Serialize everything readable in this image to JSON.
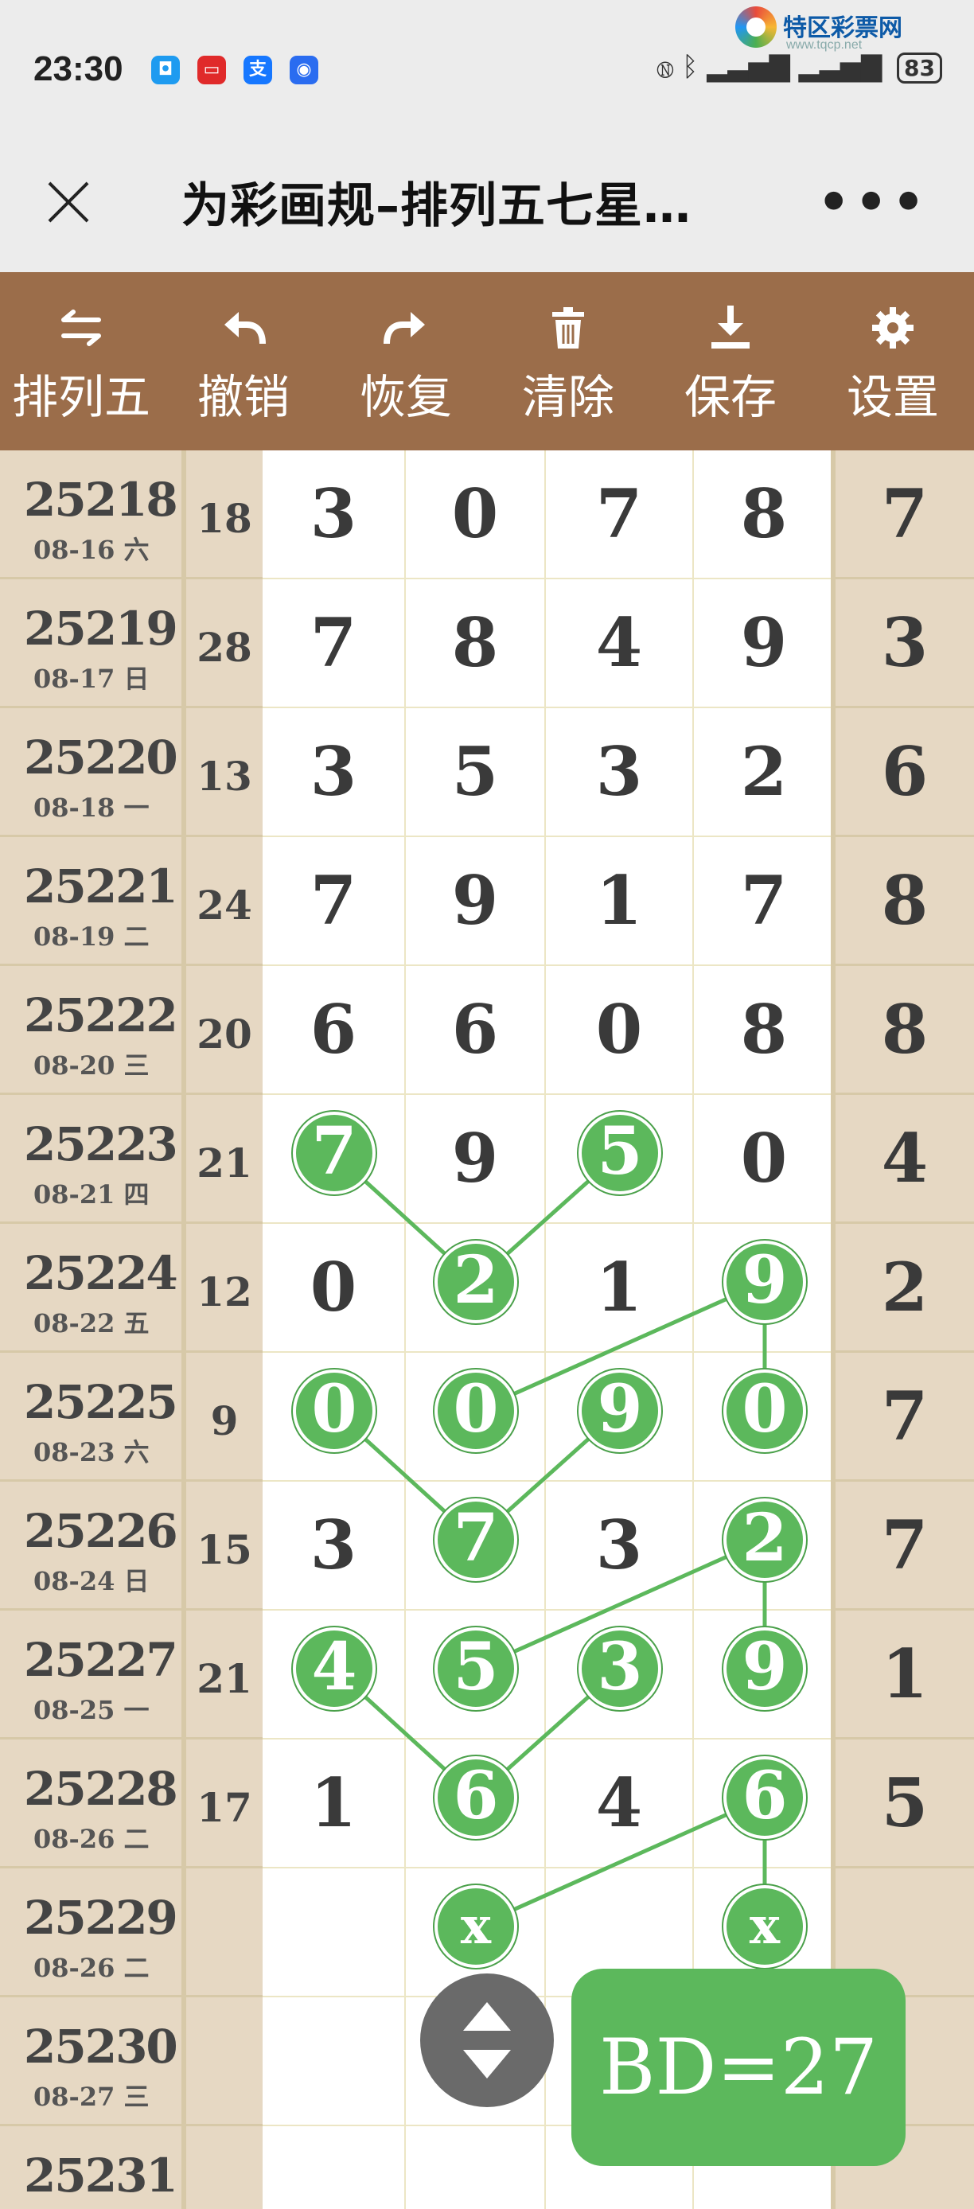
{
  "status": {
    "time": "23:30",
    "battery": "83",
    "notification_icons": [
      "qq-icon",
      "red-app-icon",
      "alipay-icon",
      "blue-app-icon"
    ],
    "alipay_label": "支"
  },
  "watermark": {
    "title": "特区彩票网",
    "url": "www.tqcp.net"
  },
  "header": {
    "title": "为彩画规–排列五七星…",
    "more": "•••"
  },
  "toolbar": {
    "items": [
      {
        "label": "排列五",
        "icon": "switch-arrows-icon"
      },
      {
        "label": "撤销",
        "icon": "undo-icon"
      },
      {
        "label": "恢复",
        "icon": "redo-icon"
      },
      {
        "label": "清除",
        "icon": "trash-icon"
      },
      {
        "label": "保存",
        "icon": "download-icon"
      },
      {
        "label": "设置",
        "icon": "gear-icon"
      }
    ]
  },
  "rows": [
    {
      "period": "25218",
      "date": "08-16 六",
      "sum": "18",
      "nums": [
        "3",
        "0",
        "7",
        "8"
      ],
      "last": "7"
    },
    {
      "period": "25219",
      "date": "08-17 日",
      "sum": "28",
      "nums": [
        "7",
        "8",
        "4",
        "9"
      ],
      "last": "3"
    },
    {
      "period": "25220",
      "date": "08-18 一",
      "sum": "13",
      "nums": [
        "3",
        "5",
        "3",
        "2"
      ],
      "last": "6"
    },
    {
      "period": "25221",
      "date": "08-19 二",
      "sum": "24",
      "nums": [
        "7",
        "9",
        "1",
        "7"
      ],
      "last": "8"
    },
    {
      "period": "25222",
      "date": "08-20 三",
      "sum": "20",
      "nums": [
        "6",
        "6",
        "0",
        "8"
      ],
      "last": "8"
    },
    {
      "period": "25223",
      "date": "08-21 四",
      "sum": "21",
      "nums": [
        "7",
        "9",
        "5",
        "0"
      ],
      "last": "4"
    },
    {
      "period": "25224",
      "date": "08-22 五",
      "sum": "12",
      "nums": [
        "0",
        "2",
        "1",
        "9"
      ],
      "last": "2"
    },
    {
      "period": "25225",
      "date": "08-23 六",
      "sum": "9",
      "nums": [
        "0",
        "0",
        "9",
        "0"
      ],
      "last": "7"
    },
    {
      "period": "25226",
      "date": "08-24 日",
      "sum": "15",
      "nums": [
        "3",
        "7",
        "3",
        "2"
      ],
      "last": "7"
    },
    {
      "period": "25227",
      "date": "08-25 一",
      "sum": "21",
      "nums": [
        "4",
        "5",
        "3",
        "9"
      ],
      "last": "1"
    },
    {
      "period": "25228",
      "date": "08-26 二",
      "sum": "17",
      "nums": [
        "1",
        "6",
        "4",
        "6"
      ],
      "last": "5"
    },
    {
      "period": "25229",
      "date": "08-26 二",
      "sum": "",
      "nums": [
        "",
        "",
        "",
        ""
      ],
      "last": ""
    },
    {
      "period": "25230",
      "date": "08-27 三",
      "sum": "",
      "nums": [
        "",
        "",
        "",
        ""
      ],
      "last": ""
    },
    {
      "period": "25231",
      "date": "",
      "sum": "",
      "nums": [
        "",
        "",
        "",
        ""
      ],
      "last": ""
    }
  ],
  "highlights": [
    {
      "row": 5,
      "col": 0,
      "text": "7"
    },
    {
      "row": 5,
      "col": 2,
      "text": "5"
    },
    {
      "row": 6,
      "col": 1,
      "text": "2"
    },
    {
      "row": 6,
      "col": 3,
      "text": "9"
    },
    {
      "row": 7,
      "col": 0,
      "text": "0"
    },
    {
      "row": 7,
      "col": 1,
      "text": "0"
    },
    {
      "row": 7,
      "col": 2,
      "text": "9"
    },
    {
      "row": 7,
      "col": 3,
      "text": "0"
    },
    {
      "row": 8,
      "col": 1,
      "text": "7"
    },
    {
      "row": 8,
      "col": 3,
      "text": "2"
    },
    {
      "row": 9,
      "col": 0,
      "text": "4"
    },
    {
      "row": 9,
      "col": 1,
      "text": "5"
    },
    {
      "row": 9,
      "col": 2,
      "text": "3"
    },
    {
      "row": 9,
      "col": 3,
      "text": "9"
    },
    {
      "row": 10,
      "col": 1,
      "text": "6"
    },
    {
      "row": 10,
      "col": 3,
      "text": "6"
    },
    {
      "row": 11,
      "col": 1,
      "text": "x"
    },
    {
      "row": 11,
      "col": 3,
      "text": "x"
    }
  ],
  "connections": [
    [
      [
        5,
        0
      ],
      [
        6,
        1
      ]
    ],
    [
      [
        5,
        2
      ],
      [
        6,
        1
      ]
    ],
    [
      [
        6,
        3
      ],
      [
        7,
        1
      ]
    ],
    [
      [
        6,
        3
      ],
      [
        7,
        3
      ]
    ],
    [
      [
        7,
        0
      ],
      [
        8,
        1
      ]
    ],
    [
      [
        7,
        2
      ],
      [
        8,
        1
      ]
    ],
    [
      [
        8,
        3
      ],
      [
        9,
        1
      ]
    ],
    [
      [
        8,
        3
      ],
      [
        9,
        3
      ]
    ],
    [
      [
        9,
        0
      ],
      [
        10,
        1
      ]
    ],
    [
      [
        9,
        2
      ],
      [
        10,
        1
      ]
    ],
    [
      [
        10,
        3
      ],
      [
        11,
        1
      ]
    ],
    [
      [
        10,
        3
      ],
      [
        11,
        3
      ]
    ]
  ],
  "bd_label": "BD=27",
  "colors": {
    "toolbar": "#9b6d4a",
    "side_cells": "#e6d8c3",
    "ball": "#5cb85c",
    "badge": "#5cb85c",
    "scroll_button": "#6a6a6a"
  }
}
